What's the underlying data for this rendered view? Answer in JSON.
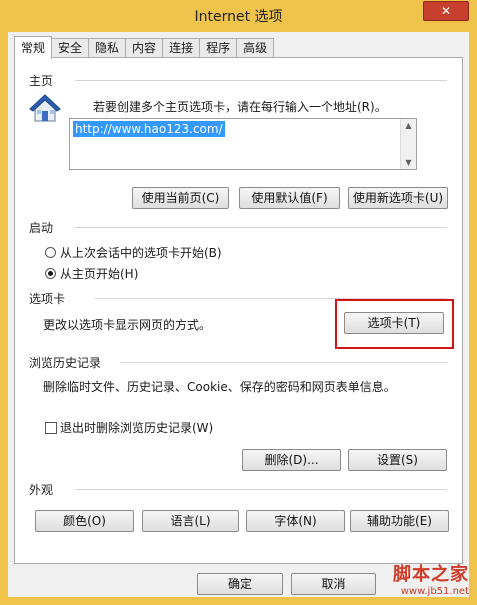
{
  "window": {
    "title": "Internet 选项",
    "close_glyph": "✕"
  },
  "tabs": [
    "常规",
    "安全",
    "隐私",
    "内容",
    "连接",
    "程序",
    "高级"
  ],
  "home": {
    "label": "主页",
    "instruction": "若要创建多个主页选项卡，请在每行输入一个地址(R)。",
    "url": "http://www.hao123.com/",
    "btn_current": "使用当前页(C)",
    "btn_default": "使用默认值(F)",
    "btn_newtab": "使用新选项卡(U)",
    "icon": "house-icon"
  },
  "startup": {
    "label": "启动",
    "option_last": "从上次会话中的选项卡开始(B)",
    "option_home": "从主页开始(H)",
    "selected": "option_home"
  },
  "tabs_section": {
    "label": "选项卡",
    "desc": "更改以选项卡显示网页的方式。",
    "button": "选项卡(T)",
    "highlight_color": "#d01515"
  },
  "history": {
    "label": "浏览历史记录",
    "desc": "删除临时文件、历史记录、Cookie、保存的密码和网页表单信息。",
    "checkbox_label": "退出时删除浏览历史记录(W)",
    "checkbox_checked": false,
    "btn_delete": "删除(D)...",
    "btn_settings": "设置(S)"
  },
  "appearance": {
    "label": "外观",
    "btn_colors": "颜色(O)",
    "btn_languages": "语言(L)",
    "btn_fonts": "字体(N)",
    "btn_accessibility": "辅助功能(E)"
  },
  "footer": {
    "ok": "确定",
    "cancel": "取消"
  },
  "watermark": {
    "main": "脚本之家",
    "url": "www.jb51.net"
  }
}
